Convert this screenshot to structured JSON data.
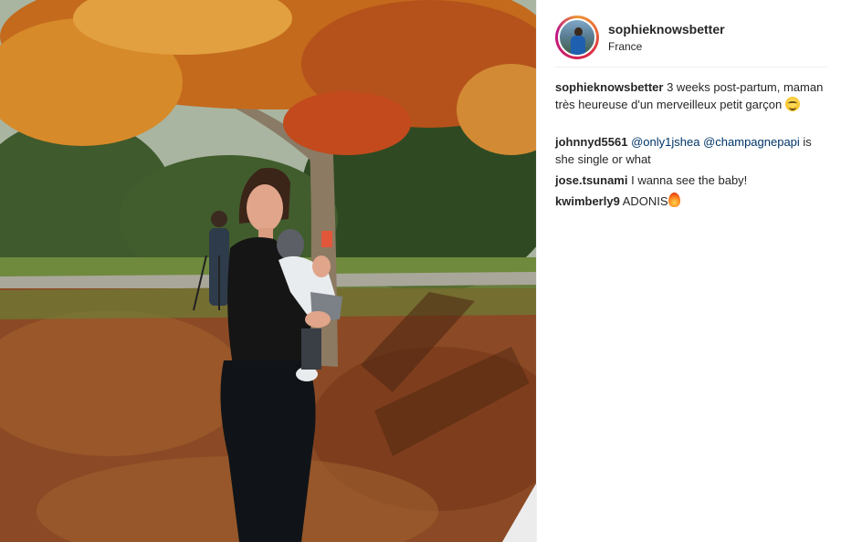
{
  "post": {
    "author": {
      "username": "sophieknowsbetter",
      "location": "France",
      "avatar_icon": "profile-avatar"
    },
    "caption": {
      "username": "sophieknowsbetter",
      "text": "3 weeks post-partum, maman très heureuse d'un merveilleux petit garçon",
      "emoji": "smiling-face-with-halo"
    },
    "comments": [
      {
        "username": "johnnyd5561",
        "mention_1": "@only1jshea",
        "mention_2": "@champagnepapi",
        "text": "is she single or what"
      },
      {
        "username": "jose.tsunami",
        "text": "I wanna see the baby!"
      },
      {
        "username": "kwimberly9",
        "text": "ADONIS",
        "emoji": "fire"
      }
    ]
  },
  "colors": {
    "link": "#003569",
    "text": "#262626",
    "divider": "#efefef",
    "ring_start": "#f09433",
    "ring_end": "#bc1888"
  }
}
